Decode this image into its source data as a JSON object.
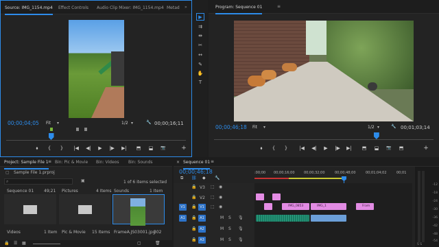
{
  "source_panel": {
    "tabs": [
      "Source: IMG_1154.mp4",
      "Effect Controls",
      "Audio Clip Mixer: IMG_1154.mp4",
      "Metad"
    ],
    "timecode_current": "00;00;04;05",
    "fit": "Fit",
    "resolution": "1/2",
    "timecode_duration": "00;00;16;11",
    "playhead_fraction": 0.25
  },
  "program_panel": {
    "title": "Program: Sequence 01",
    "timecode_current": "00;00;46;18",
    "fit": "Fit",
    "resolution": "1/2",
    "timecode_duration": "00;01;03;14",
    "playhead_fraction": 0.74
  },
  "transport_glyphs": {
    "marker": "⬧",
    "in": "{",
    "out": "}",
    "go_in": "|◀",
    "step_back": "◀|",
    "play": "▶",
    "step_fwd": "|▶",
    "go_out": "▶|",
    "insert": "⬒",
    "overwrite": "⬓",
    "export": "📷",
    "add": "+",
    "wrench": "🔧"
  },
  "tools": {
    "icons": [
      "selection-tool-icon",
      "track-select-icon",
      "ripple-edit-icon",
      "razor-icon",
      "slip-icon",
      "pen-icon",
      "hand-icon",
      "type-icon"
    ],
    "glyphs": [
      "▶",
      "⇉",
      "⇹",
      "✂",
      "↔",
      "✎",
      "✋",
      "T"
    ]
  },
  "project_panel": {
    "tabs": [
      "Project: Sample File 1",
      "Bin: Pic & Movie",
      "Bin: Videos",
      "Bin: Sounds"
    ],
    "file": "Sample File 1.prproj",
    "selection_status": "1 of 6 items selected",
    "items": [
      {
        "name": "Sequence 01",
        "meta": "49;21"
      },
      {
        "name": "Pictures",
        "meta": "4 Items"
      },
      {
        "name": "Sounds",
        "meta": "1 Item"
      },
      {
        "name": "Videos",
        "meta": "1 Item"
      },
      {
        "name": "Pic & Movie",
        "meta": "15 Items"
      },
      {
        "name": "FrameA.JS03001.jpg",
        "meta": "302"
      }
    ]
  },
  "timeline_panel": {
    "title": "Sequence 01",
    "timecode": "00;00;46;18",
    "ruler_labels": [
      ":00;00",
      "00;00;16;00",
      "00;00;32;00",
      "00;00;48;00",
      "00;01;04;02",
      "00;01"
    ],
    "tracks_video": [
      "V3",
      "V2",
      "V1"
    ],
    "tracks_audio": [
      "A1",
      "A2",
      "A3"
    ],
    "source_patch_video": "V1",
    "source_patch_audio": "A1",
    "mute_label": "M",
    "solo_label": "S",
    "clip_labels": [
      "IMG_0853",
      "IMG_1",
      "Fram"
    ],
    "meter_labels": [
      "-12",
      "-18",
      "-24",
      "-30",
      "-36",
      "-42",
      "-48",
      "-54"
    ],
    "meter_bottom": "S S"
  },
  "colors": {
    "accent": "#2d8ceb",
    "video_clip": "#e48ce4",
    "audio_clip": "#1a7a62",
    "audio_clip_alt": "#6b9fd8"
  }
}
